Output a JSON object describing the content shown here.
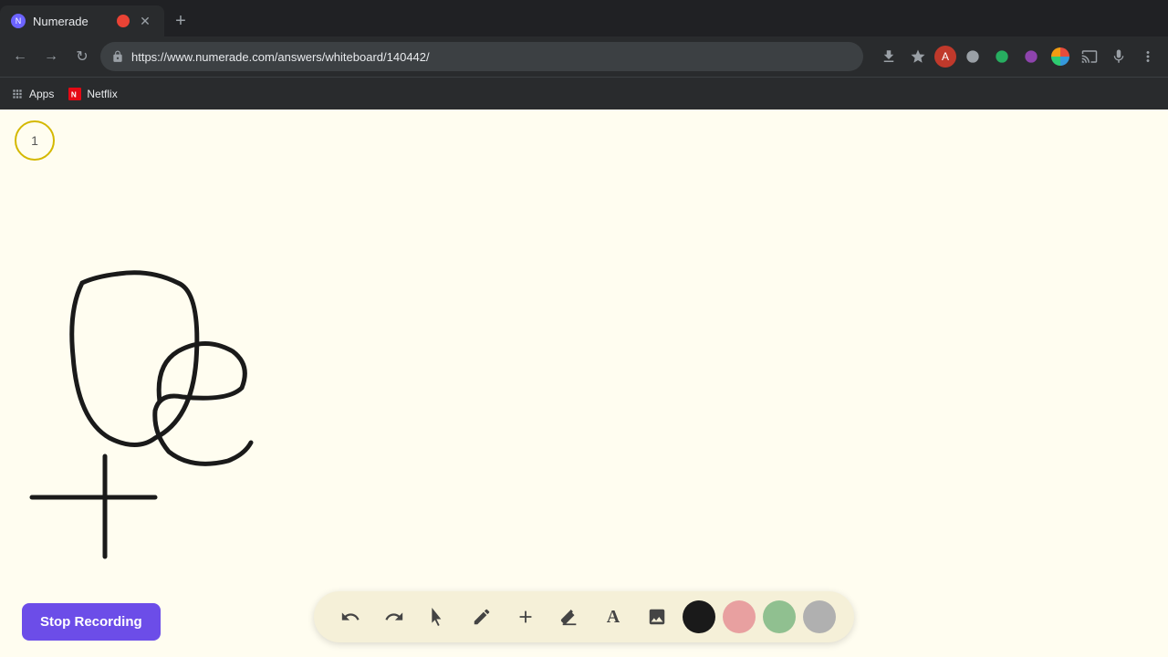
{
  "browser": {
    "tab": {
      "title": "Numerade",
      "favicon_color": "#6c63ff",
      "url": "https://www.numerade.com/answers/whiteboard/140442/"
    },
    "bookmarks": [
      {
        "label": "Apps"
      },
      {
        "label": "Netflix"
      }
    ]
  },
  "whiteboard": {
    "page_number": "1",
    "background_color": "#fffdf0"
  },
  "toolbar": {
    "tools": [
      {
        "name": "undo",
        "icon": "↩",
        "label": "Undo"
      },
      {
        "name": "redo",
        "icon": "↪",
        "label": "Redo"
      },
      {
        "name": "select",
        "icon": "▶",
        "label": "Select"
      },
      {
        "name": "pencil",
        "icon": "✏",
        "label": "Pencil"
      },
      {
        "name": "add",
        "icon": "+",
        "label": "Add"
      },
      {
        "name": "eraser",
        "icon": "/",
        "label": "Eraser"
      },
      {
        "name": "text",
        "icon": "A",
        "label": "Text"
      },
      {
        "name": "image",
        "icon": "🖼",
        "label": "Image"
      }
    ],
    "colors": [
      {
        "name": "black",
        "value": "#1a1a1a"
      },
      {
        "name": "pink",
        "value": "#e8a0a0"
      },
      {
        "name": "green",
        "value": "#90c090"
      },
      {
        "name": "gray",
        "value": "#b0b0b0"
      }
    ]
  },
  "stop_recording": {
    "label": "Stop Recording",
    "bg_color": "#6c4de8"
  }
}
